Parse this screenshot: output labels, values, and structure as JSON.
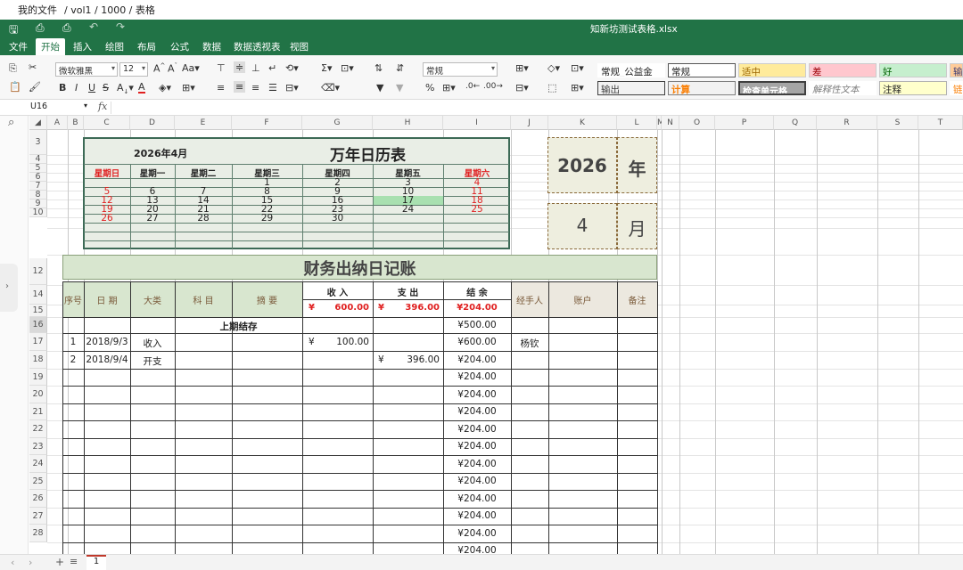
{
  "topbar": {
    "my_files": "我的文件",
    "path": "/ vol1 / 1000 / 表格"
  },
  "titlebar": {
    "filename": "知新坊测试表格.xlsx"
  },
  "menu": [
    "文件",
    "开始",
    "插入",
    "绘图",
    "布局",
    "公式",
    "数据",
    "数据透视表",
    "视图"
  ],
  "active_menu": "开始",
  "ribbon": {
    "font_name": "微软雅黑",
    "font_size": "12",
    "number_format": "常规",
    "styles_row1": [
      "常规_公益金",
      "常规",
      "适中",
      "差",
      "好",
      "输"
    ],
    "styles_row2": [
      "输出",
      "计算",
      "检查单元格",
      "解释性文本",
      "注释",
      "链"
    ]
  },
  "formula_bar": {
    "cell_ref": "U16",
    "fx": "fx",
    "value": ""
  },
  "columns": [
    "A",
    "B",
    "C",
    "D",
    "E",
    "F",
    "G",
    "H",
    "I",
    "J",
    "K",
    "L",
    "M",
    "N",
    "O",
    "P",
    "Q",
    "R",
    "S",
    "T"
  ],
  "rows": [
    "3",
    "4",
    "5",
    "6",
    "7",
    "8",
    "9",
    "10",
    "12",
    "14",
    "15",
    "16",
    "17",
    "18",
    "19",
    "20",
    "21",
    "22",
    "23",
    "24",
    "25",
    "26",
    "27",
    "28"
  ],
  "calendar": {
    "month_label": "2026年4月",
    "title": "万年日历表",
    "weekdays": [
      "星期日",
      "星期一",
      "星期二",
      "星期三",
      "星期四",
      "星期五",
      "星期六"
    ],
    "weeks": [
      [
        "",
        "",
        "",
        "1",
        "2",
        "3",
        "4"
      ],
      [
        "5",
        "6",
        "7",
        "8",
        "9",
        "10",
        "11"
      ],
      [
        "12",
        "13",
        "14",
        "15",
        "16",
        "17",
        "18"
      ],
      [
        "19",
        "20",
        "21",
        "22",
        "23",
        "24",
        "25"
      ],
      [
        "26",
        "27",
        "28",
        "29",
        "30",
        "",
        ""
      ],
      [
        "",
        "",
        "",
        "",
        "",
        "",
        ""
      ]
    ],
    "highlight_day": "17",
    "year": "2026",
    "year_label": "年",
    "month": "4",
    "month_label2": "月"
  },
  "ledger": {
    "title": "财务出纳日记账",
    "headers": [
      "序号",
      "日 期",
      "大类",
      "科 目",
      "摘 要",
      "收 入",
      "支 出",
      "结 余",
      "经手人",
      "账户",
      "备注"
    ],
    "totals": {
      "income_sym": "¥",
      "income": "600.00",
      "expense_sym": "¥",
      "expense": "396.00",
      "balance": "¥204.00"
    },
    "opening_label": "上期结存",
    "opening_balance": "¥500.00",
    "rows": [
      {
        "no": "1",
        "date": "2018/9/3",
        "cat": "收入",
        "income_sym": "¥",
        "income": "100.00",
        "expense_sym": "",
        "expense": "",
        "balance": "¥600.00",
        "handler": "杨钦"
      },
      {
        "no": "2",
        "date": "2018/9/4",
        "cat": "开支",
        "income_sym": "",
        "income": "",
        "expense_sym": "¥",
        "expense": "396.00",
        "balance": "¥204.00",
        "handler": ""
      }
    ],
    "empty_balances": [
      "¥204.00",
      "¥204.00",
      "¥204.00",
      "¥204.00",
      "¥204.00",
      "¥204.00",
      "¥204.00",
      "¥204.00",
      "¥204.00",
      "¥204.00",
      "¥204.00",
      "¥204.00"
    ],
    "partial_balance": "¥204.00"
  },
  "sheet_tab": "1",
  "colors": {
    "green": "#217346",
    "cal_bg": "#e9eee6",
    "ledger_hdr": "#d8e6cf",
    "hl": "#a8e0b0",
    "year_box": "#eeeedf"
  }
}
